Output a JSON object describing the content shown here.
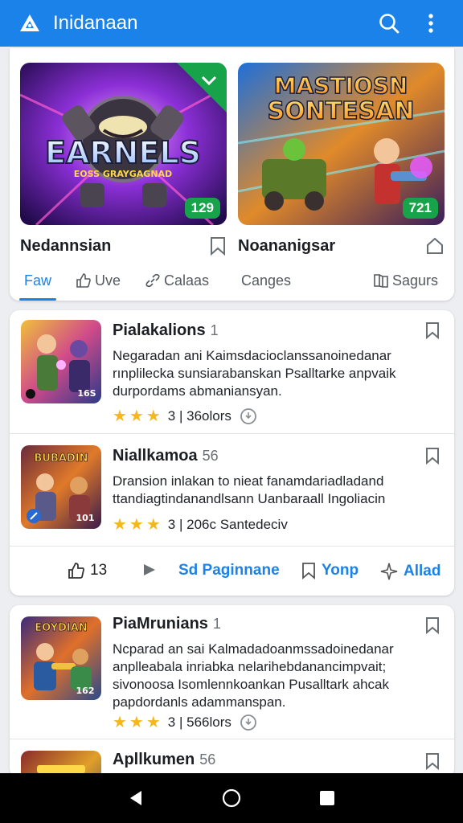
{
  "app": {
    "title": "Inidanaan"
  },
  "featured": [
    {
      "name": "Nedannsian",
      "badge": "129",
      "art_title": "EARNELS",
      "art_sub": "EOSS GRAYGAGNAD"
    },
    {
      "name": "Noananigsar",
      "badge": "721",
      "art_title": "MASTIOSN",
      "art_sub": "SONTESAN"
    }
  ],
  "tabs": [
    {
      "label": "Faw",
      "icon": "none",
      "active": true
    },
    {
      "label": "Uve",
      "icon": "thumb-icon"
    },
    {
      "label": "Calaas",
      "icon": "link-icon"
    },
    {
      "label": "Canges",
      "icon": "none"
    },
    {
      "label": "Sagurs",
      "icon": "book-icon"
    }
  ],
  "items": [
    {
      "title": "Pialakalions",
      "count": "1",
      "desc": [
        "Negaradan ani Kaimsdacioclanssanoinedanar",
        "rınplilecka sunsiarabanskan Psalltarke anpvaik",
        "durpordams abmaniansyan."
      ],
      "rating": "3 | 36olors",
      "thumb_tag": "16S"
    },
    {
      "title": "Niallkamoa",
      "count": "56",
      "desc": [
        "Dransion inlakan to nieat fanamdariadladand",
        "ttandiagtindanandlsann Uanbaraall Ingoliacin"
      ],
      "rating": "3 | 206c Santedeciv",
      "thumb_tag": "101",
      "thumb_title": "BUBADIN"
    },
    {
      "title": "PiaMrunians",
      "count": "1",
      "desc": [
        "Ncparad an sai Kalmadadoanmssadoinedanar",
        "anplleabala inriabka nelarihebdanancimpvait;",
        "sivonoosa Isomlennkoankan Pusalltark ahcak",
        "papdordanls adammanspan."
      ],
      "rating": "3 | 566lors",
      "thumb_tag": "162",
      "thumb_title": "EOYDIAN"
    },
    {
      "title": "Apllkumen",
      "count": "56"
    }
  ],
  "actions": {
    "likes": "13",
    "page": "Sd Paginnane",
    "save": "Yonp",
    "add": "Allad"
  },
  "colors": {
    "primary": "#1a82e8",
    "star": "#f5b81c",
    "badge": "#16a34a"
  }
}
